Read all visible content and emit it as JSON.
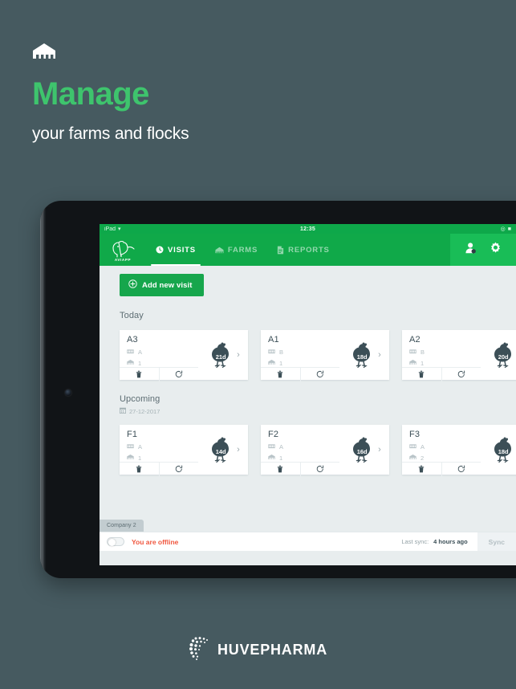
{
  "hero": {
    "icon": "barn-icon",
    "headline": "Manage",
    "subline": "your farms and flocks",
    "headline_color": "#3ec46d",
    "background_color": "#465a60"
  },
  "device": {
    "statusbar": {
      "device_label": "iPad",
      "wifi_icon": "wifi-icon",
      "time": "12:35",
      "battery_icon": "battery-icon"
    }
  },
  "app": {
    "brand": {
      "logo_icon": "chicken-outline-logo",
      "name": "AVIAPP"
    },
    "nav": {
      "tabs": [
        {
          "label": "VISITS",
          "icon": "clock-icon",
          "active": true
        },
        {
          "label": "FARMS",
          "icon": "barn-icon",
          "active": false
        },
        {
          "label": "REPORTS",
          "icon": "document-icon",
          "active": false
        }
      ],
      "actions": [
        {
          "name": "user-icon",
          "label": ""
        },
        {
          "name": "gear-icon",
          "label": ""
        }
      ],
      "accent_color": "#10a949",
      "accent_light_color": "#19bd57"
    },
    "toolbar": {
      "add_visit_label": "Add new visit",
      "add_visit_icon": "plus-circle-icon"
    },
    "sections": [
      {
        "title": "Today",
        "date": "",
        "date_icon": "",
        "cards": [
          {
            "title": "A3",
            "house": "A",
            "flock": "1",
            "days": "21d",
            "house_icon": "barn-row-icon",
            "flock_icon": "barn-icon",
            "delete_icon": "trash-icon",
            "reset_icon": "restore-icon",
            "chicken_icon": "chicken-icon",
            "chevron": "›"
          },
          {
            "title": "A1",
            "house": "B",
            "flock": "1",
            "days": "18d",
            "house_icon": "barn-row-icon",
            "flock_icon": "barn-icon",
            "delete_icon": "trash-icon",
            "reset_icon": "restore-icon",
            "chicken_icon": "chicken-icon",
            "chevron": "›"
          },
          {
            "title": "A2",
            "house": "B",
            "flock": "1",
            "days": "20d",
            "house_icon": "barn-row-icon",
            "flock_icon": "barn-icon",
            "delete_icon": "trash-icon",
            "reset_icon": "restore-icon",
            "chicken_icon": "chicken-icon",
            "chevron": "›"
          }
        ]
      },
      {
        "title": "Upcoming",
        "date": "27-12-2017",
        "date_icon": "calendar-icon",
        "cards": [
          {
            "title": "F1",
            "house": "A",
            "flock": "1",
            "days": "14d",
            "house_icon": "barn-row-icon",
            "flock_icon": "barn-icon",
            "delete_icon": "trash-icon",
            "reset_icon": "restore-icon",
            "chicken_icon": "chicken-icon",
            "chevron": "›"
          },
          {
            "title": "F2",
            "house": "A",
            "flock": "1",
            "days": "16d",
            "house_icon": "barn-row-icon",
            "flock_icon": "barn-icon",
            "delete_icon": "trash-icon",
            "reset_icon": "restore-icon",
            "chicken_icon": "chicken-icon",
            "chevron": "›"
          },
          {
            "title": "F3",
            "house": "A",
            "flock": "2",
            "days": "18d",
            "house_icon": "barn-row-icon",
            "flock_icon": "barn-icon",
            "delete_icon": "trash-icon",
            "reset_icon": "restore-icon",
            "chicken_icon": "chicken-icon",
            "chevron": "›"
          }
        ]
      }
    ],
    "company_tab": {
      "label": "Company 2"
    },
    "footer": {
      "offline_toggle_state": "off",
      "offline_text": "You are offline",
      "offline_color": "#f0573f",
      "last_sync_label": "Last sync:",
      "last_sync_value": "4 hours ago",
      "sync_button_label": "Sync"
    }
  },
  "brand_footer": {
    "logo_icon": "huvepharma-dots-logo",
    "name": "HUVEPHARMA"
  }
}
